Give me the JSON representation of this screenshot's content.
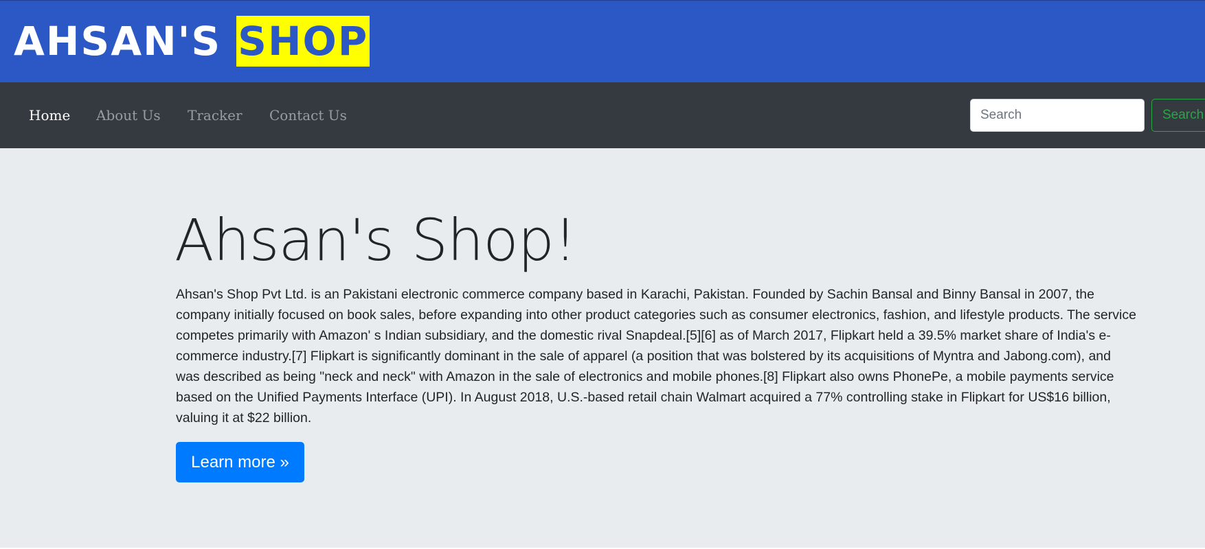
{
  "brand": {
    "part1": "AHSAN'S",
    "part2": "SHOP"
  },
  "nav": {
    "items": [
      {
        "label": "Home",
        "active": true
      },
      {
        "label": "About Us",
        "active": false
      },
      {
        "label": "Tracker",
        "active": false
      },
      {
        "label": "Contact Us",
        "active": false
      }
    ]
  },
  "search": {
    "placeholder": "Search",
    "value": "",
    "button_label": "Search"
  },
  "jumbotron": {
    "title": "Ahsan's Shop!",
    "lead": "Ahsan's Shop Pvt Ltd. is an Pakistani electronic commerce company based in Karachi, Pakistan. Founded by Sachin Bansal and Binny Bansal in 2007, the company initially focused on book sales, before expanding into other product categories such as consumer electronics, fashion, and lifestyle products. The service competes primarily with Amazon' s Indian subsidiary, and the domestic rival Snapdeal.[5][6] as of March 2017, Flipkart held a 39.5% market share of India's e-commerce industry.[7] Flipkart is significantly dominant in the sale of apparel (a position that was bolstered by its acquisitions of Myntra and Jabong.com), and was described as being \"neck and neck\" with Amazon in the sale of electronics and mobile phones.[8] Flipkart also owns PhonePe, a mobile payments service based on the Unified Payments Interface (UPI). In August 2018, U.S.-based retail chain Walmart acquired a 77% controlling stake in Flipkart for US$16 billion, valuing it at $22 billion.",
    "button_label": "Learn more »"
  },
  "colors": {
    "banner": "#2b58c4",
    "brand_highlight": "#ffff00",
    "navbar": "#343a40",
    "jumbotron": "#e9ecef",
    "primary": "#007bff",
    "success": "#28a745"
  }
}
